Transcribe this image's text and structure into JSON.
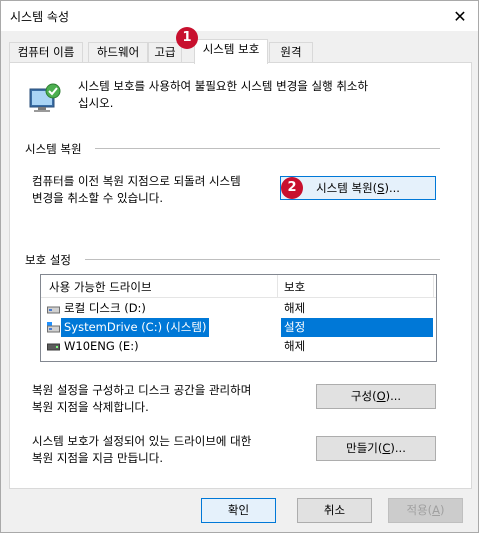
{
  "window": {
    "title": "시스템 속성",
    "close_symbol": "✕"
  },
  "tabs": [
    {
      "label": "컴퓨터 이름"
    },
    {
      "label": "하드웨어"
    },
    {
      "label": "고급"
    },
    {
      "label": "시스템 보호"
    },
    {
      "label": "원격"
    }
  ],
  "badges": {
    "tab": "1",
    "restore": "2"
  },
  "intro": {
    "line1": "시스템 보호를 사용하여 불필요한 시스템 변경을 실행 취소하",
    "line2": "십시오."
  },
  "restore_section": {
    "label": "시스템 복원",
    "desc_line1": "컴퓨터를 이전 복원 지점으로 되돌려 시스템",
    "desc_line2": "변경을 취소할 수 있습니다.",
    "button_label": "시스템 복원(S)...",
    "button_mnemonic_pre": "시스템 복원(",
    "button_mnemonic_key": "S",
    "button_mnemonic_post": ")..."
  },
  "protection_section": {
    "label": "보호 설정",
    "columns": [
      "사용 가능한 드라이브",
      "보호"
    ],
    "rows": [
      {
        "name": "로컬 디스크 (D:)",
        "protection": "해제",
        "icon": "local-disk-icon"
      },
      {
        "name": "SystemDrive (C:) (시스템)",
        "protection": "설정",
        "icon": "system-drive-icon"
      },
      {
        "name": "W10ENG (E:)",
        "protection": "해제",
        "icon": "drive-icon"
      }
    ]
  },
  "configure": {
    "desc_line1": "복원 설정을 구성하고 디스크 공간을 관리하며",
    "desc_line2": "복원 지점을 삭제합니다.",
    "btn_pre": "구성(",
    "btn_key": "O",
    "btn_post": ")..."
  },
  "create": {
    "desc_line1": "시스템 보호가 설정되어 있는 드라이브에 대한",
    "desc_line2": "복원 지점을 지금 만듭니다.",
    "btn_pre": "만들기(",
    "btn_key": "C",
    "btn_post": ")..."
  },
  "footer": {
    "ok": "확인",
    "cancel": "취소",
    "apply_pre": "적용(",
    "apply_key": "A",
    "apply_post": ")"
  },
  "colors": {
    "badge": "#c8102e",
    "selection": "#0078d7",
    "focus_border": "#0078d7"
  }
}
